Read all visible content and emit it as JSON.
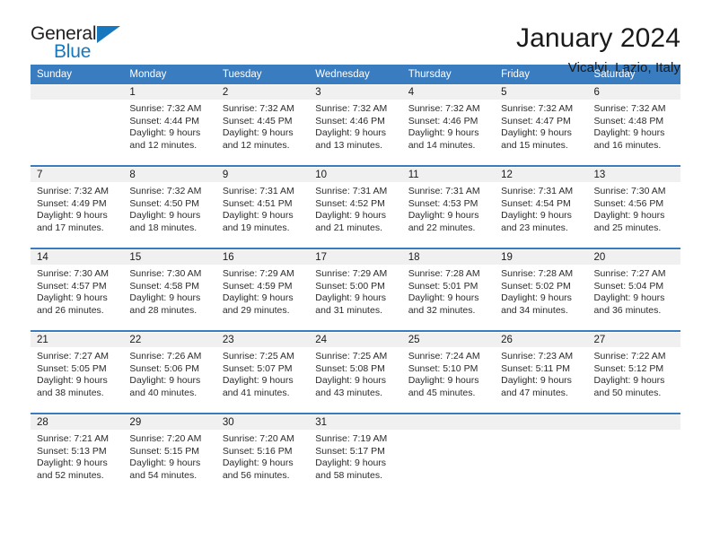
{
  "brand": {
    "name_part1": "General",
    "name_part2": "Blue",
    "flag_icon": "triangle-flag-icon"
  },
  "header": {
    "title": "January 2024",
    "location": "Vicalvi, Lazio, Italy"
  },
  "calendar": {
    "weekday_headers": [
      "Sunday",
      "Monday",
      "Tuesday",
      "Wednesday",
      "Thursday",
      "Friday",
      "Saturday"
    ],
    "header_bg": "#3a7cc0",
    "daynum_bg": "#f0f0f0",
    "weeks": [
      [
        {
          "day": "",
          "lines": []
        },
        {
          "day": "1",
          "lines": [
            "Sunrise: 7:32 AM",
            "Sunset: 4:44 PM",
            "Daylight: 9 hours",
            "and 12 minutes."
          ]
        },
        {
          "day": "2",
          "lines": [
            "Sunrise: 7:32 AM",
            "Sunset: 4:45 PM",
            "Daylight: 9 hours",
            "and 12 minutes."
          ]
        },
        {
          "day": "3",
          "lines": [
            "Sunrise: 7:32 AM",
            "Sunset: 4:46 PM",
            "Daylight: 9 hours",
            "and 13 minutes."
          ]
        },
        {
          "day": "4",
          "lines": [
            "Sunrise: 7:32 AM",
            "Sunset: 4:46 PM",
            "Daylight: 9 hours",
            "and 14 minutes."
          ]
        },
        {
          "day": "5",
          "lines": [
            "Sunrise: 7:32 AM",
            "Sunset: 4:47 PM",
            "Daylight: 9 hours",
            "and 15 minutes."
          ]
        },
        {
          "day": "6",
          "lines": [
            "Sunrise: 7:32 AM",
            "Sunset: 4:48 PM",
            "Daylight: 9 hours",
            "and 16 minutes."
          ]
        }
      ],
      [
        {
          "day": "7",
          "lines": [
            "Sunrise: 7:32 AM",
            "Sunset: 4:49 PM",
            "Daylight: 9 hours",
            "and 17 minutes."
          ]
        },
        {
          "day": "8",
          "lines": [
            "Sunrise: 7:32 AM",
            "Sunset: 4:50 PM",
            "Daylight: 9 hours",
            "and 18 minutes."
          ]
        },
        {
          "day": "9",
          "lines": [
            "Sunrise: 7:31 AM",
            "Sunset: 4:51 PM",
            "Daylight: 9 hours",
            "and 19 minutes."
          ]
        },
        {
          "day": "10",
          "lines": [
            "Sunrise: 7:31 AM",
            "Sunset: 4:52 PM",
            "Daylight: 9 hours",
            "and 21 minutes."
          ]
        },
        {
          "day": "11",
          "lines": [
            "Sunrise: 7:31 AM",
            "Sunset: 4:53 PM",
            "Daylight: 9 hours",
            "and 22 minutes."
          ]
        },
        {
          "day": "12",
          "lines": [
            "Sunrise: 7:31 AM",
            "Sunset: 4:54 PM",
            "Daylight: 9 hours",
            "and 23 minutes."
          ]
        },
        {
          "day": "13",
          "lines": [
            "Sunrise: 7:30 AM",
            "Sunset: 4:56 PM",
            "Daylight: 9 hours",
            "and 25 minutes."
          ]
        }
      ],
      [
        {
          "day": "14",
          "lines": [
            "Sunrise: 7:30 AM",
            "Sunset: 4:57 PM",
            "Daylight: 9 hours",
            "and 26 minutes."
          ]
        },
        {
          "day": "15",
          "lines": [
            "Sunrise: 7:30 AM",
            "Sunset: 4:58 PM",
            "Daylight: 9 hours",
            "and 28 minutes."
          ]
        },
        {
          "day": "16",
          "lines": [
            "Sunrise: 7:29 AM",
            "Sunset: 4:59 PM",
            "Daylight: 9 hours",
            "and 29 minutes."
          ]
        },
        {
          "day": "17",
          "lines": [
            "Sunrise: 7:29 AM",
            "Sunset: 5:00 PM",
            "Daylight: 9 hours",
            "and 31 minutes."
          ]
        },
        {
          "day": "18",
          "lines": [
            "Sunrise: 7:28 AM",
            "Sunset: 5:01 PM",
            "Daylight: 9 hours",
            "and 32 minutes."
          ]
        },
        {
          "day": "19",
          "lines": [
            "Sunrise: 7:28 AM",
            "Sunset: 5:02 PM",
            "Daylight: 9 hours",
            "and 34 minutes."
          ]
        },
        {
          "day": "20",
          "lines": [
            "Sunrise: 7:27 AM",
            "Sunset: 5:04 PM",
            "Daylight: 9 hours",
            "and 36 minutes."
          ]
        }
      ],
      [
        {
          "day": "21",
          "lines": [
            "Sunrise: 7:27 AM",
            "Sunset: 5:05 PM",
            "Daylight: 9 hours",
            "and 38 minutes."
          ]
        },
        {
          "day": "22",
          "lines": [
            "Sunrise: 7:26 AM",
            "Sunset: 5:06 PM",
            "Daylight: 9 hours",
            "and 40 minutes."
          ]
        },
        {
          "day": "23",
          "lines": [
            "Sunrise: 7:25 AM",
            "Sunset: 5:07 PM",
            "Daylight: 9 hours",
            "and 41 minutes."
          ]
        },
        {
          "day": "24",
          "lines": [
            "Sunrise: 7:25 AM",
            "Sunset: 5:08 PM",
            "Daylight: 9 hours",
            "and 43 minutes."
          ]
        },
        {
          "day": "25",
          "lines": [
            "Sunrise: 7:24 AM",
            "Sunset: 5:10 PM",
            "Daylight: 9 hours",
            "and 45 minutes."
          ]
        },
        {
          "day": "26",
          "lines": [
            "Sunrise: 7:23 AM",
            "Sunset: 5:11 PM",
            "Daylight: 9 hours",
            "and 47 minutes."
          ]
        },
        {
          "day": "27",
          "lines": [
            "Sunrise: 7:22 AM",
            "Sunset: 5:12 PM",
            "Daylight: 9 hours",
            "and 50 minutes."
          ]
        }
      ],
      [
        {
          "day": "28",
          "lines": [
            "Sunrise: 7:21 AM",
            "Sunset: 5:13 PM",
            "Daylight: 9 hours",
            "and 52 minutes."
          ]
        },
        {
          "day": "29",
          "lines": [
            "Sunrise: 7:20 AM",
            "Sunset: 5:15 PM",
            "Daylight: 9 hours",
            "and 54 minutes."
          ]
        },
        {
          "day": "30",
          "lines": [
            "Sunrise: 7:20 AM",
            "Sunset: 5:16 PM",
            "Daylight: 9 hours",
            "and 56 minutes."
          ]
        },
        {
          "day": "31",
          "lines": [
            "Sunrise: 7:19 AM",
            "Sunset: 5:17 PM",
            "Daylight: 9 hours",
            "and 58 minutes."
          ]
        },
        {
          "day": "",
          "lines": []
        },
        {
          "day": "",
          "lines": []
        },
        {
          "day": "",
          "lines": []
        }
      ]
    ]
  }
}
